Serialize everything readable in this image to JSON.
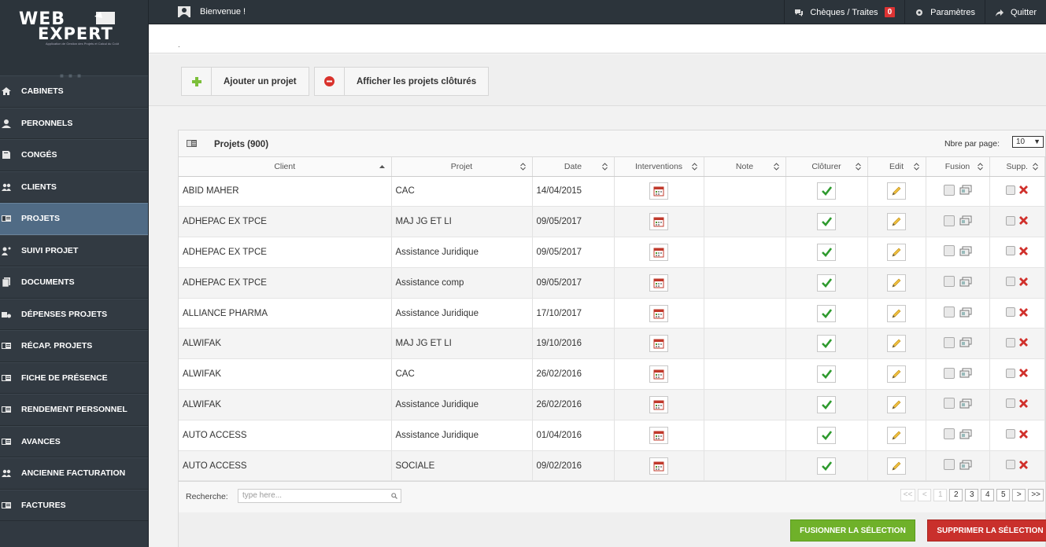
{
  "brand": {
    "line1": "WEB",
    "line2": "EXPERT",
    "tagline": "Application de Gestion des Projets et Calcul du Coût"
  },
  "topbar": {
    "welcome": "Bienvenue !",
    "cheques_label": "Chèques / Traites",
    "cheques_count": "0",
    "settings_label": "Paramètres",
    "quit_label": "Quitter"
  },
  "sidebar": {
    "items": [
      {
        "label": "CABINETS",
        "icon": "home-icon"
      },
      {
        "label": "PERONNELS",
        "icon": "user-icon"
      },
      {
        "label": "CONGÉS",
        "icon": "book-icon"
      },
      {
        "label": "CLIENTS",
        "icon": "users-icon"
      },
      {
        "label": "PROJETS",
        "icon": "list-icon",
        "active": true
      },
      {
        "label": "SUIVI PROJET",
        "icon": "user-follow-icon"
      },
      {
        "label": "DOCUMENTS",
        "icon": "documents-icon"
      },
      {
        "label": "DÉPENSES PROJETS",
        "icon": "money-icon"
      },
      {
        "label": "RÉCAP. PROJETS",
        "icon": "list-icon"
      },
      {
        "label": "FICHE DE PRÉSENCE",
        "icon": "list-icon"
      },
      {
        "label": "RENDEMENT PERSONNEL",
        "icon": "list-icon"
      },
      {
        "label": "AVANCES",
        "icon": "list-icon"
      },
      {
        "label": "ANCIENNE FACTURATION",
        "icon": "users-icon"
      },
      {
        "label": "FACTURES",
        "icon": "list-icon"
      }
    ]
  },
  "breadcrumb": ".",
  "toolbar": {
    "add_label": "Ajouter un projet",
    "closed_label": "Afficher les projets clôturés"
  },
  "panel": {
    "title": "Projets (900)",
    "per_page_label": "Nbre par page:",
    "per_page_value": "10",
    "columns": [
      "Client",
      "Projet",
      "Date",
      "Interventions",
      "Note",
      "Clôturer",
      "Edit",
      "Fusion",
      "Supp."
    ],
    "rows": [
      {
        "client": "ABID MAHER",
        "projet": "CAC",
        "date": "14/04/2015"
      },
      {
        "client": "ADHEPAC EX TPCE",
        "projet": "MAJ JG ET LI",
        "date": "09/05/2017"
      },
      {
        "client": "ADHEPAC EX TPCE",
        "projet": "Assistance Juridique",
        "date": "09/05/2017"
      },
      {
        "client": "ADHEPAC EX TPCE",
        "projet": "Assistance comp",
        "date": "09/05/2017"
      },
      {
        "client": "ALLIANCE PHARMA",
        "projet": "Assistance Juridique",
        "date": "17/10/2017"
      },
      {
        "client": "ALWIFAK",
        "projet": "MAJ JG ET LI",
        "date": "19/10/2016"
      },
      {
        "client": "ALWIFAK",
        "projet": "CAC",
        "date": "26/02/2016"
      },
      {
        "client": "ALWIFAK",
        "projet": "Assistance Juridique",
        "date": "26/02/2016"
      },
      {
        "client": "AUTO ACCESS",
        "projet": "Assistance Juridique",
        "date": "01/04/2016"
      },
      {
        "client": "AUTO ACCESS",
        "projet": "SOCIALE",
        "date": "09/02/2016"
      }
    ],
    "search_label": "Recherche:",
    "search_placeholder": "type here...",
    "pager": [
      "<<",
      "<",
      "1",
      "2",
      "3",
      "4",
      "5",
      ">",
      ">>"
    ],
    "merge_label": "FUSIONNER LA SÉLECTION",
    "delete_label": "SUPPRIMER LA SÉLECTION"
  },
  "colors": {
    "sidebar": "#313941",
    "active": "#506b85",
    "green": "#6fb12a",
    "red": "#c9302c"
  }
}
